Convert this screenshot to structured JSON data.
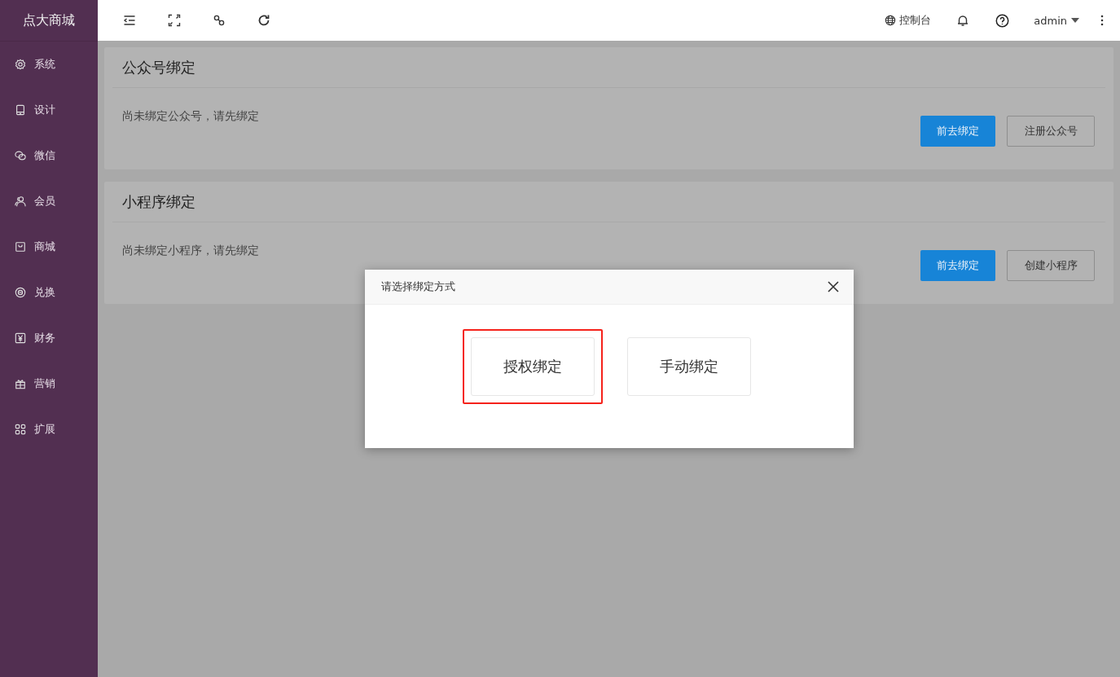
{
  "sidebar": {
    "logo": "点大商城",
    "items": [
      {
        "kind": "gear",
        "label": "系统"
      },
      {
        "kind": "tablet",
        "label": "设计"
      },
      {
        "kind": "chat",
        "label": "微信"
      },
      {
        "kind": "users",
        "label": "会员"
      },
      {
        "kind": "bag",
        "label": "商城"
      },
      {
        "kind": "coin",
        "label": "兑换"
      },
      {
        "kind": "yen",
        "label": "财务"
      },
      {
        "kind": "gift",
        "label": "营销"
      },
      {
        "kind": "grid",
        "label": "扩展"
      }
    ]
  },
  "header": {
    "console": "控制台",
    "user": "admin"
  },
  "cards": [
    {
      "title": "公众号绑定",
      "message": "尚未绑定公众号，请先绑定",
      "primary": "前去绑定",
      "secondary": "注册公众号"
    },
    {
      "title": "小程序绑定",
      "message": "尚未绑定小程序，请先绑定",
      "primary": "前去绑定",
      "secondary": "创建小程序"
    }
  ],
  "dialog": {
    "title": "请选择绑定方式",
    "options": [
      {
        "label": "授权绑定",
        "highlighted": true
      },
      {
        "label": "手动绑定",
        "highlighted": false
      }
    ]
  }
}
